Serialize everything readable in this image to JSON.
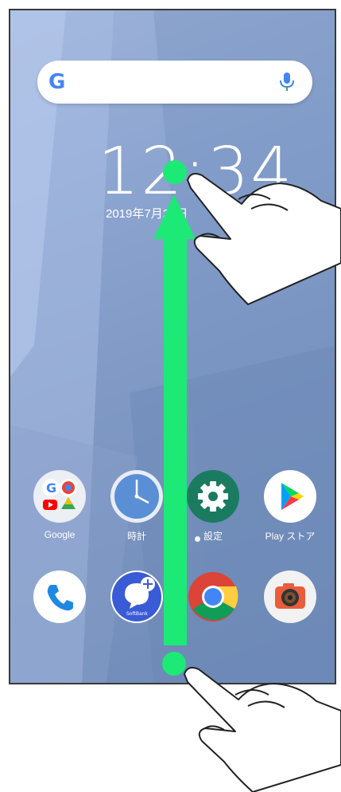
{
  "search": {
    "logo_letter": "G"
  },
  "lock": {
    "time": "12:34",
    "date": "2019年7月26日"
  },
  "apps": [
    {
      "label": "Google",
      "icon": "google-folder-icon"
    },
    {
      "label": "時計",
      "icon": "clock-icon"
    },
    {
      "label": "設定",
      "icon": "settings-gear-icon"
    },
    {
      "label": "Play ストア",
      "icon": "play-store-icon"
    }
  ],
  "dock": [
    {
      "icon": "phone-icon"
    },
    {
      "icon": "softbank-messaging-icon",
      "sub": "SoftBank"
    },
    {
      "icon": "chrome-icon"
    },
    {
      "icon": "camera-icon"
    }
  ],
  "colors": {
    "arrow": "#1de977",
    "google_blue": "#4285f4"
  }
}
